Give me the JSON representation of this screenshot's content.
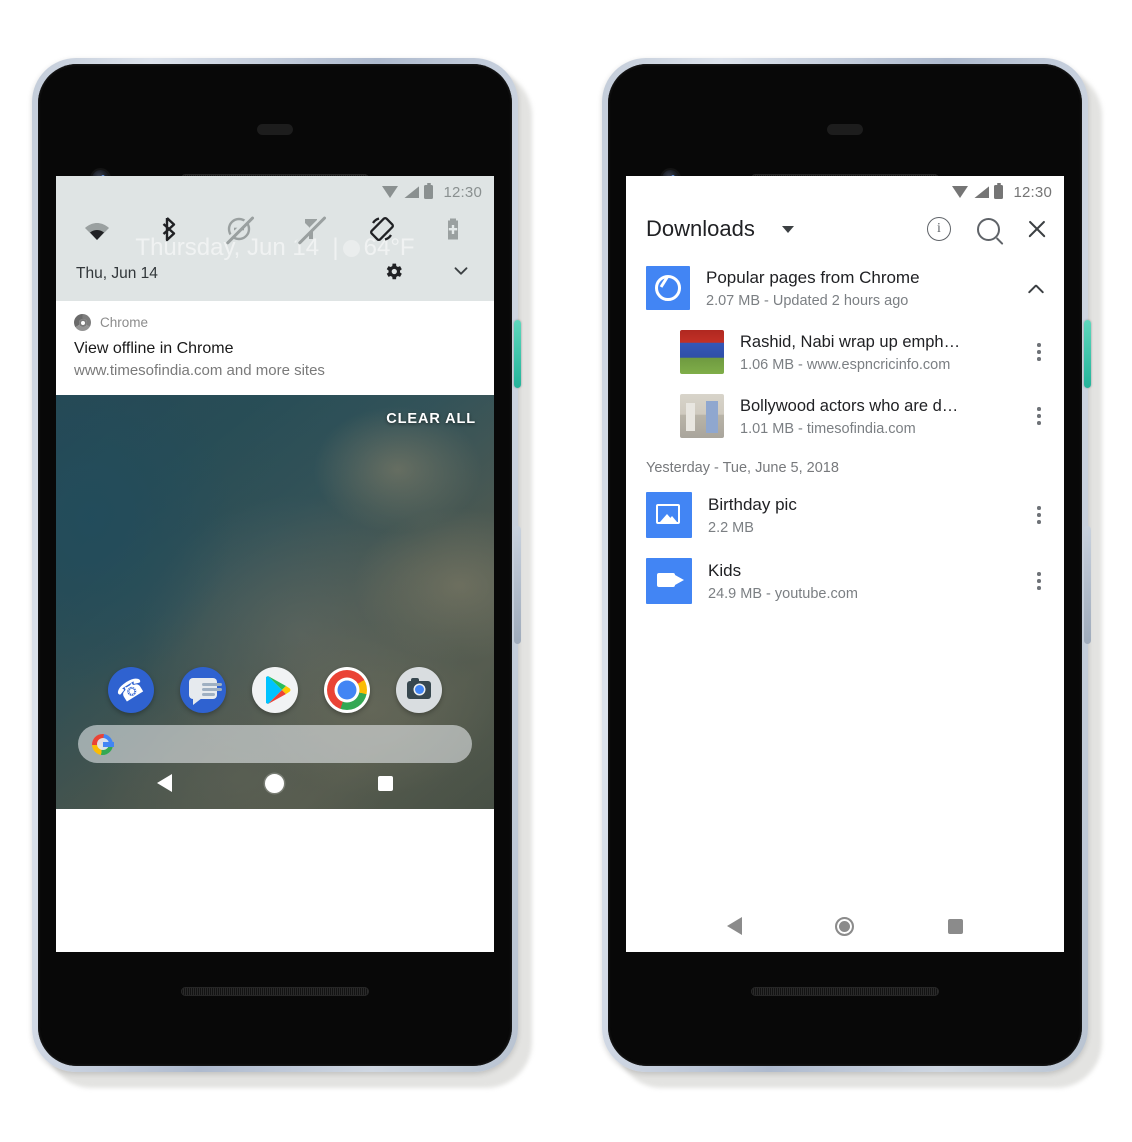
{
  "left_phone": {
    "status_bar": {
      "wifi": "wifi-icon",
      "signal": "signal-icon",
      "battery": "battery-icon",
      "time": "12:30"
    },
    "quick_settings": {
      "tiles": [
        {
          "name": "wifi-tile",
          "label": "Wi-Fi",
          "state": "on"
        },
        {
          "name": "bluetooth-tile",
          "label": "Bluetooth",
          "state": "on"
        },
        {
          "name": "do-not-disturb-tile",
          "label": "Do Not Disturb",
          "state": "off"
        },
        {
          "name": "flashlight-tile",
          "label": "Flashlight",
          "state": "off"
        },
        {
          "name": "auto-rotate-tile",
          "label": "Auto-rotate",
          "state": "on"
        },
        {
          "name": "battery-saver-tile",
          "label": "Battery Saver",
          "state": "off"
        }
      ],
      "ghost_text": "Thursday, Jun 14",
      "ghost_temp": "64°F",
      "date": "Thu, Jun 14",
      "settings_icon": "gear-icon",
      "expand_icon": "chevron-down-icon"
    },
    "notification": {
      "app_icon": "chrome-icon",
      "app_name": "Chrome",
      "title": "View offline in Chrome",
      "subtitle": "www.timesofindia.com and more sites"
    },
    "home": {
      "clear_all": "CLEAR ALL",
      "dock": [
        {
          "name": "phone-app",
          "label": "Phone"
        },
        {
          "name": "messages-app",
          "label": "Messages"
        },
        {
          "name": "play-store-app",
          "label": "Play Store"
        },
        {
          "name": "chrome-app",
          "label": "Chrome"
        },
        {
          "name": "camera-app",
          "label": "Camera"
        }
      ],
      "search_placeholder": ""
    },
    "nav": {
      "back": "back-icon",
      "home": "home-icon",
      "recents": "recents-icon"
    }
  },
  "right_phone": {
    "status_bar": {
      "wifi": "wifi-icon",
      "signal": "signal-icon",
      "battery": "battery-icon",
      "time": "12:30"
    },
    "appbar": {
      "title": "Downloads",
      "dropdown_icon": "chevron-down-icon",
      "info_icon": "info-icon",
      "info_glyph": "i",
      "search_icon": "search-icon",
      "close_icon": "close-icon"
    },
    "group": {
      "icon": "chrome-icon",
      "title": "Popular pages from Chrome",
      "meta": "2.07 MB - Updated 2 hours ago",
      "collapse_icon": "chevron-up-icon",
      "children": [
        {
          "thumb": "cricket-thumbnail",
          "title": "Rashid, Nabi wrap up emph…",
          "meta": "1.06 MB - www.espncricinfo.com",
          "menu_icon": "more-vert-icon"
        },
        {
          "thumb": "news-thumbnail",
          "title": "Bollywood actors who are d…",
          "meta": "1.01 MB - timesofindia.com",
          "menu_icon": "more-vert-icon"
        }
      ]
    },
    "date_header": "Yesterday - Tue, June 5, 2018",
    "items": [
      {
        "icon": "image-icon",
        "title": "Birthday pic",
        "meta": "2.2 MB",
        "menu_icon": "more-vert-icon"
      },
      {
        "icon": "video-icon",
        "title": "Kids",
        "meta": "24.9 MB - youtube.com",
        "menu_icon": "more-vert-icon"
      }
    ],
    "nav": {
      "back": "back-icon",
      "home": "home-icon",
      "recents": "recents-icon"
    }
  },
  "colors": {
    "accent_blue": "#4285F4",
    "shade_bg": "#DFE4E4",
    "text_primary": "#202124",
    "text_secondary": "#7B7F83",
    "power_button": "#35C2A6"
  }
}
